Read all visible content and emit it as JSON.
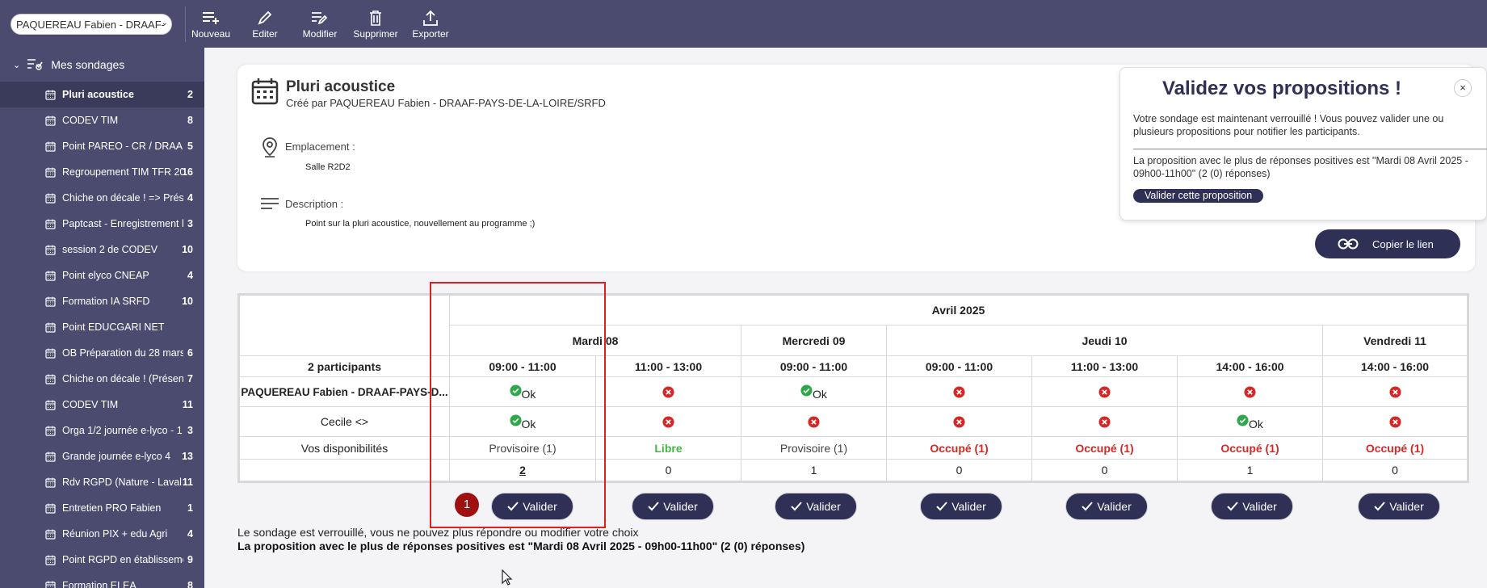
{
  "topbar": {
    "user_select": "PAQUEREAU Fabien - DRAAF-",
    "buttons": [
      {
        "label": "Nouveau",
        "icon": "new-icon"
      },
      {
        "label": "Editer",
        "icon": "pencil-icon"
      },
      {
        "label": "Modifier",
        "icon": "edit-list-icon"
      },
      {
        "label": "Supprimer",
        "icon": "trash-icon"
      },
      {
        "label": "Exporter",
        "icon": "export-icon"
      }
    ]
  },
  "sidebar": {
    "header": "Mes sondages",
    "items": [
      {
        "label": "Pluri acoustice",
        "count": "2"
      },
      {
        "label": "CODEV TIM",
        "count": "8"
      },
      {
        "label": "Point PAREO - CR / DRAAF",
        "count": "5"
      },
      {
        "label": "Regroupement TIM TFR 20",
        "count": "16"
      },
      {
        "label": "Chiche on décale ! => Prése",
        "count": "4"
      },
      {
        "label": "Paptcast - Enregistrement l",
        "count": "3"
      },
      {
        "label": "session 2 de CODEV",
        "count": "10"
      },
      {
        "label": "Point elyco CNEAP",
        "count": "4"
      },
      {
        "label": "Formation IA SRFD",
        "count": "10"
      },
      {
        "label": "Point EDUCGARI NET",
        "count": ""
      },
      {
        "label": "OB Préparation du 28 mars",
        "count": "6"
      },
      {
        "label": "Chiche on décale ! (Présent",
        "count": "7"
      },
      {
        "label": "CODEV TIM",
        "count": "11"
      },
      {
        "label": "Orga 1/2 journée e-lyco - 1",
        "count": "3"
      },
      {
        "label": "Grande journée e-lyco 4",
        "count": "13"
      },
      {
        "label": "Rdv RGPD (Nature - Laval e",
        "count": "11"
      },
      {
        "label": "Entretien PRO Fabien",
        "count": "1"
      },
      {
        "label": "Réunion PIX + edu Agri",
        "count": "4"
      },
      {
        "label": "Point RGPD en établisseme",
        "count": "9"
      },
      {
        "label": "Formation ELEA",
        "count": "8"
      }
    ]
  },
  "poll": {
    "title": "Pluri acoustice",
    "created_by": "Créé par PAQUEREAU Fabien - DRAAF-PAYS-DE-LA-LOIRE/SRFD",
    "location_label": "Emplacement :",
    "location_value": "Salle R2D2",
    "description_label": "Description :",
    "description_value": "Point sur la pluri acoustice, nouvellement au programme ;)",
    "copy_link": "Copier le lien"
  },
  "popup": {
    "title": "Validez vos propositions !",
    "text": "Votre sondage est maintenant verrouillé ! Vous pouvez valider une ou plusieurs propositions pour notifier les participants.",
    "best": "La proposition avec le plus de réponses positives est \"Mardi 08 Avril 2025 - 09h00-11h00\" (2 (0) réponses)",
    "button": "Valider cette proposition",
    "close": "×"
  },
  "table": {
    "month": "Avril 2025",
    "days": [
      "Mardi 08",
      "Mercredi 09",
      "Jeudi 10",
      "Vendredi 11"
    ],
    "slots": [
      "09:00 - 11:00",
      "11:00 - 13:00",
      "09:00 - 11:00",
      "09:00 - 11:00",
      "11:00 - 13:00",
      "14:00 - 16:00",
      "14:00 - 16:00"
    ],
    "participants_label": "2 participants",
    "participants": [
      {
        "name": "PAQUEREAU Fabien - DRAAF-PAYS-D...",
        "answers": [
          "ok",
          "no",
          "ok",
          "no",
          "no",
          "no",
          "no"
        ]
      },
      {
        "name": "Cecile <>",
        "answers": [
          "ok",
          "no",
          "no",
          "no",
          "no",
          "ok",
          "no"
        ]
      }
    ],
    "ok_label": "Ok",
    "availability_label": "Vos disponibilités",
    "availability": [
      "Provisoire (1)",
      "Libre",
      "Provisoire (1)",
      "Occupé (1)",
      "Occupé (1)",
      "Occupé (1)",
      "Occupé (1)"
    ],
    "counts": [
      "2",
      "0",
      "1",
      "0",
      "0",
      "1",
      "0"
    ],
    "validate_label": "Valider"
  },
  "step_badge": "1",
  "footer": {
    "locked": "Le sondage est verrouillé, vous ne pouvez plus répondre ou modifier votre choix",
    "best": "La proposition avec le plus de réponses positives est \"Mardi 08 Avril 2025 - 09h00-11h00\" (2 (0) réponses)"
  },
  "colors": {
    "primary": "#2e3056",
    "sidebar": "#4a4b6e",
    "ok": "#2ea84a",
    "no": "#d42828",
    "libre": "#44b544"
  }
}
